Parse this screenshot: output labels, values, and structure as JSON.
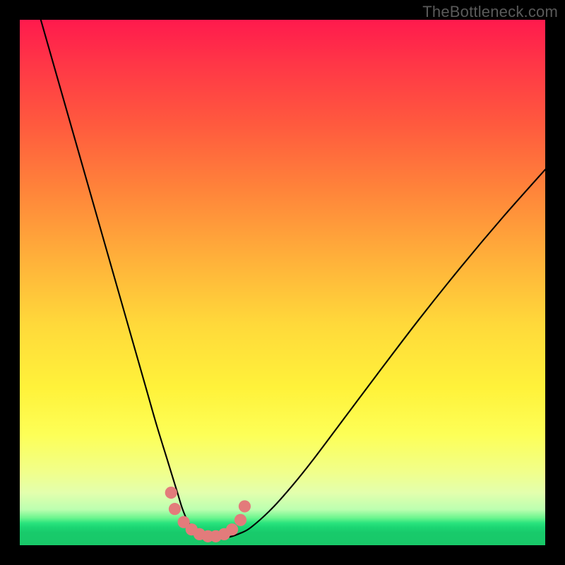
{
  "watermark": "TheBottleneck.com",
  "chart_data": {
    "type": "line",
    "title": "",
    "xlabel": "",
    "ylabel": "",
    "xlim": [
      0,
      100
    ],
    "ylim": [
      0,
      100
    ],
    "grid": false,
    "legend": false,
    "series": [
      {
        "name": "curve",
        "color": "#000000",
        "x": [
          4,
          8,
          12,
          16,
          20,
          24,
          26,
          28,
          30,
          31,
          32,
          33,
          34,
          36,
          38,
          40,
          42,
          44,
          48,
          52,
          56,
          62,
          68,
          76,
          84,
          92,
          100
        ],
        "y": [
          100,
          86,
          72,
          58,
          44,
          30,
          23,
          16.5,
          10,
          6.8,
          4.5,
          3.1,
          2.3,
          1.6,
          1.5,
          1.6,
          2.3,
          3.4,
          7.0,
          11.5,
          16.5,
          24.5,
          32.5,
          43.0,
          53.0,
          62.5,
          71.5
        ]
      },
      {
        "name": "valley-markers",
        "color": "#e37b7b",
        "type": "scatter",
        "x": [
          28.8,
          29.5,
          31.2,
          32.7,
          34.2,
          35.8,
          37.3,
          38.9,
          40.4,
          42.0,
          42.8
        ],
        "y": [
          10.0,
          6.9,
          4.4,
          3.0,
          2.1,
          1.7,
          1.7,
          2.1,
          3.0,
          4.8,
          7.4
        ]
      }
    ],
    "annotations": []
  },
  "colors": {
    "frame": "#000000",
    "curve": "#000000",
    "markers": "#e37b7b",
    "gradient_top": "#ff1a4d",
    "gradient_mid": "#fff23a",
    "gradient_bottom": "#18c868"
  }
}
